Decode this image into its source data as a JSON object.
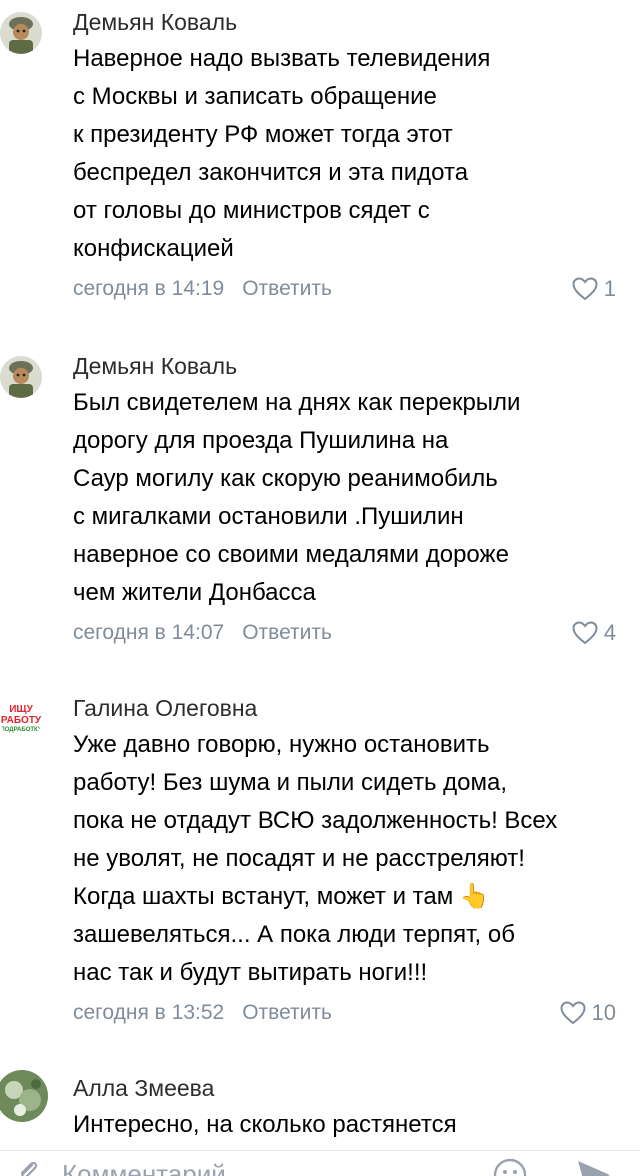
{
  "comments": [
    {
      "author": "Демьян Коваль",
      "text": "Наверное надо вызвать телевидения\nс Москвы и записать обращение\nк президенту РФ может тогда этот\nбеспредел  закончится  и эта пидота\nот головы до министров сядет с\nконфискацией",
      "time": "сегодня в 14:19",
      "reply_label": "Ответить",
      "likes": "1"
    },
    {
      "author": "Демьян Коваль",
      "text": "Был свидетелем на днях как перекрыли\nдорогу для проезда Пушилина на\nСаур могилу  как скорую реанимобиль\nс мигалками остановили  .Пушилин\nнаверное со своими медалями дороже\nчем жители Донбасса",
      "time": "сегодня в 14:07",
      "reply_label": "Ответить",
      "likes": "4"
    },
    {
      "author": "Галина Олеговна",
      "avatar_text": [
        "ИЩУ",
        "РАБОТУ",
        "ПОДРАБОТКУ"
      ],
      "text": "Уже давно говорю, нужно остановить\nработу! Без шума и пыли сидеть дома,\nпока не отдадут ВСЮ задолженность! Всех\nне уволят, не посадят и не расстреляют!\nКогда шахты встанут, может и там 👆\nзашевеляться... А пока люди терпят, об\nнас так и будут вытирать ноги!!!",
      "time": "сегодня в 13:52",
      "reply_label": "Ответить",
      "likes": "10"
    },
    {
      "author": "Алла Змеева",
      "text": "Интересно, на сколько растянется"
    }
  ],
  "composer": {
    "placeholder": "Комментарий",
    "icons": [
      "attach-icon",
      "emoji-icon",
      "send-icon"
    ]
  },
  "colors": {
    "secondary_text": "#818c99",
    "author": "#2c2d2e",
    "ad_red": "#e0252b",
    "ad_green": "#2e8b2e"
  }
}
